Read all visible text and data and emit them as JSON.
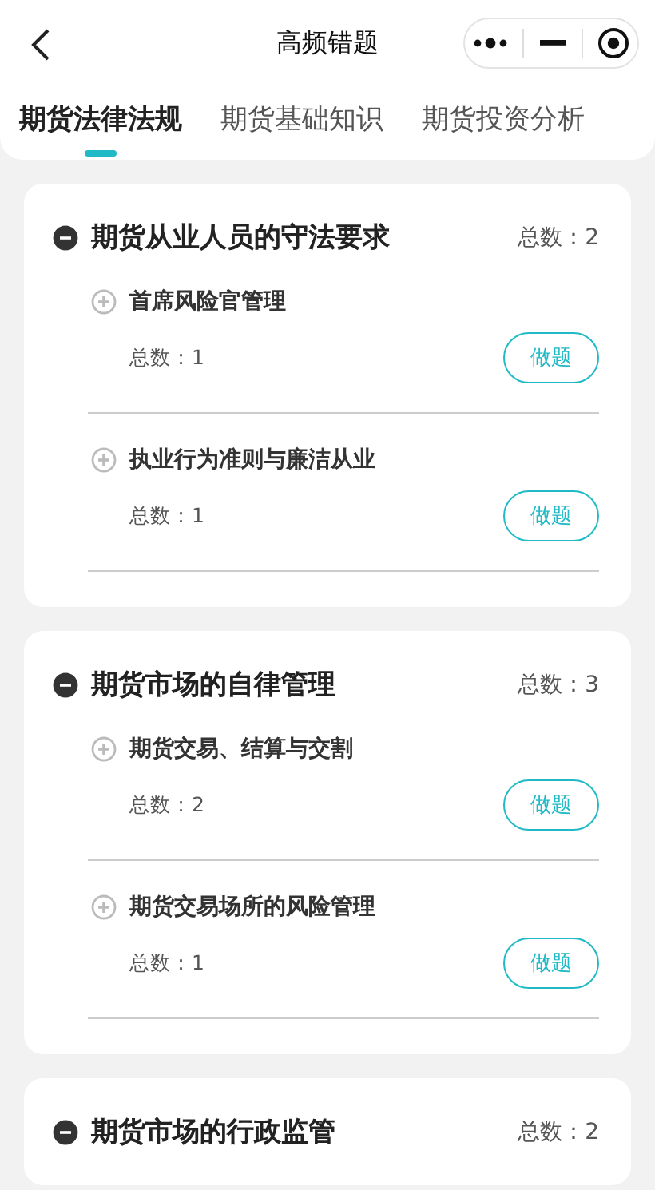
{
  "nav_bar": {
    "title": "高频错题"
  },
  "tabs": [
    {
      "label": "期货法律法规",
      "selected": true
    },
    {
      "label": "期货基础知识",
      "selected": false
    },
    {
      "label": "期货投资分析",
      "selected": false
    }
  ],
  "sections": [
    {
      "title": "期货从业人员的守法要求",
      "count": "总数：2",
      "expanded": true,
      "items": [
        {
          "title": "首席风险官管理",
          "count": "总数：1",
          "expanded": false,
          "button": "做题"
        },
        {
          "title": "执业行为准则与廉洁从业",
          "count": "总数：1",
          "expanded": false,
          "button": "做题"
        }
      ]
    },
    {
      "title": "期货市场的自律管理",
      "count": "总数：3",
      "expanded": true,
      "items": [
        {
          "title": "期货交易、结算与交割",
          "count": "总数：2",
          "expanded": false,
          "button": "做题"
        },
        {
          "title": "期货交易场所的风险管理",
          "count": "总数：1",
          "expanded": false,
          "button": "做题"
        }
      ]
    },
    {
      "title": "期货市场的行政监管",
      "count": "总数：2",
      "expanded": true
    }
  ]
}
